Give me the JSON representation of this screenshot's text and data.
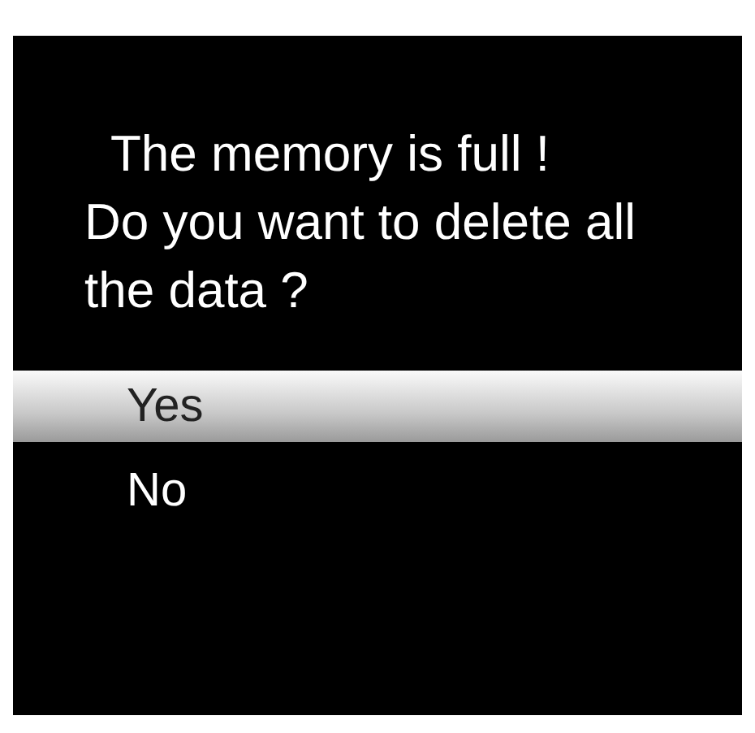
{
  "message": [
    "The memory is full !",
    "Do you want to delete all",
    "the data ?"
  ],
  "options": [
    {
      "label": "Yes",
      "selected": true
    },
    {
      "label": "No",
      "selected": false
    }
  ]
}
